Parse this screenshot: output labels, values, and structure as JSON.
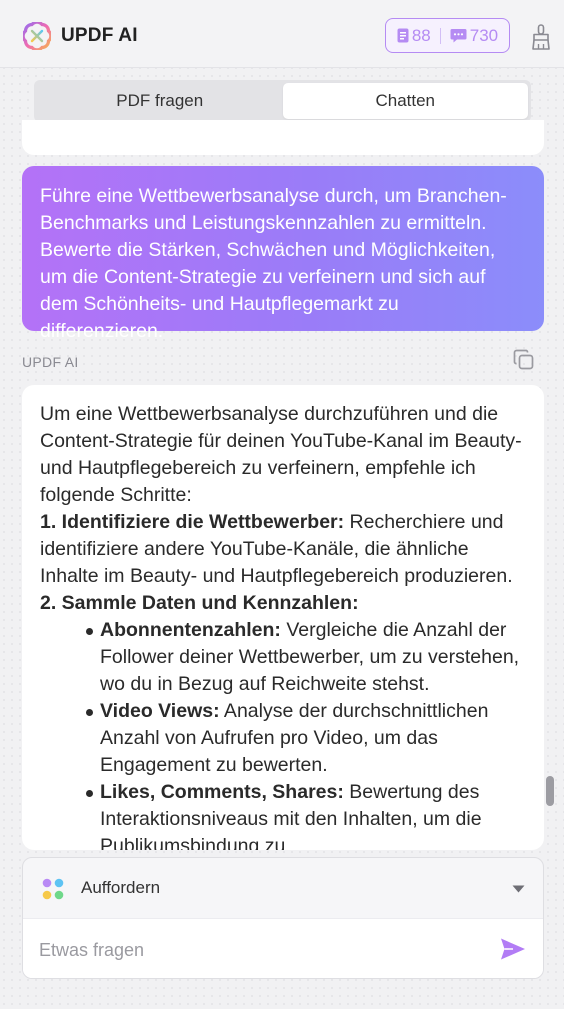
{
  "app": {
    "title": "UPDF AI",
    "accent_color": "#b58bf3"
  },
  "header": {
    "credits_doc_count": "88",
    "credits_chat_count": "730",
    "doc_icon": "document-icon",
    "chat_icon": "chat-bubble-icon",
    "clean_icon": "broom-icon"
  },
  "tabs": [
    {
      "label": "PDF fragen",
      "active": false
    },
    {
      "label": "Chatten",
      "active": true
    }
  ],
  "user_message": {
    "text": "Führe eine Wettbewerbsanalyse durch, um Branchen-Benchmarks und Leistungskennzahlen zu ermitteln. Bewerte die Stärken, Schwächen und Möglichkeiten, um die Content-Strategie zu verfeinern und sich auf dem Schönheits- und Hautpflegemarkt zu differenzieren."
  },
  "ai_message": {
    "label": "UPDF AI",
    "intro": "Um eine Wettbewerbsanalyse durchzuführen und die Content-Strategie für deinen YouTube-Kanal im Beauty- und Hautpflegebereich zu verfeinern, empfehle ich folgende Schritte:",
    "step1_title": "1. Identifiziere die Wettbewerber:",
    "step1_text": " Recherchiere und identifiziere andere YouTube-Kanäle, die ähnliche Inhalte im Beauty- und Hautpflegebereich produzieren.",
    "step2_title": "2. Sammle Daten und Kennzahlen:",
    "bullets": [
      {
        "title": "Abonnentenzahlen:",
        "text": " Vergleiche die Anzahl der Follower deiner Wettbewerber, um zu verstehen, wo du in Bezug auf Reichweite stehst."
      },
      {
        "title": "Video Views:",
        "text": " Analyse der durchschnittlichen Anzahl von Aufrufen pro Video, um das Engagement zu bewerten."
      },
      {
        "title": "Likes, Comments, Shares:",
        "text": " Bewertung des Interaktionsniveaus mit den Inhalten, um die Publikumsbindung zu"
      }
    ]
  },
  "composer": {
    "prompt_label": "Auffordern",
    "placeholder": "Etwas fragen"
  }
}
